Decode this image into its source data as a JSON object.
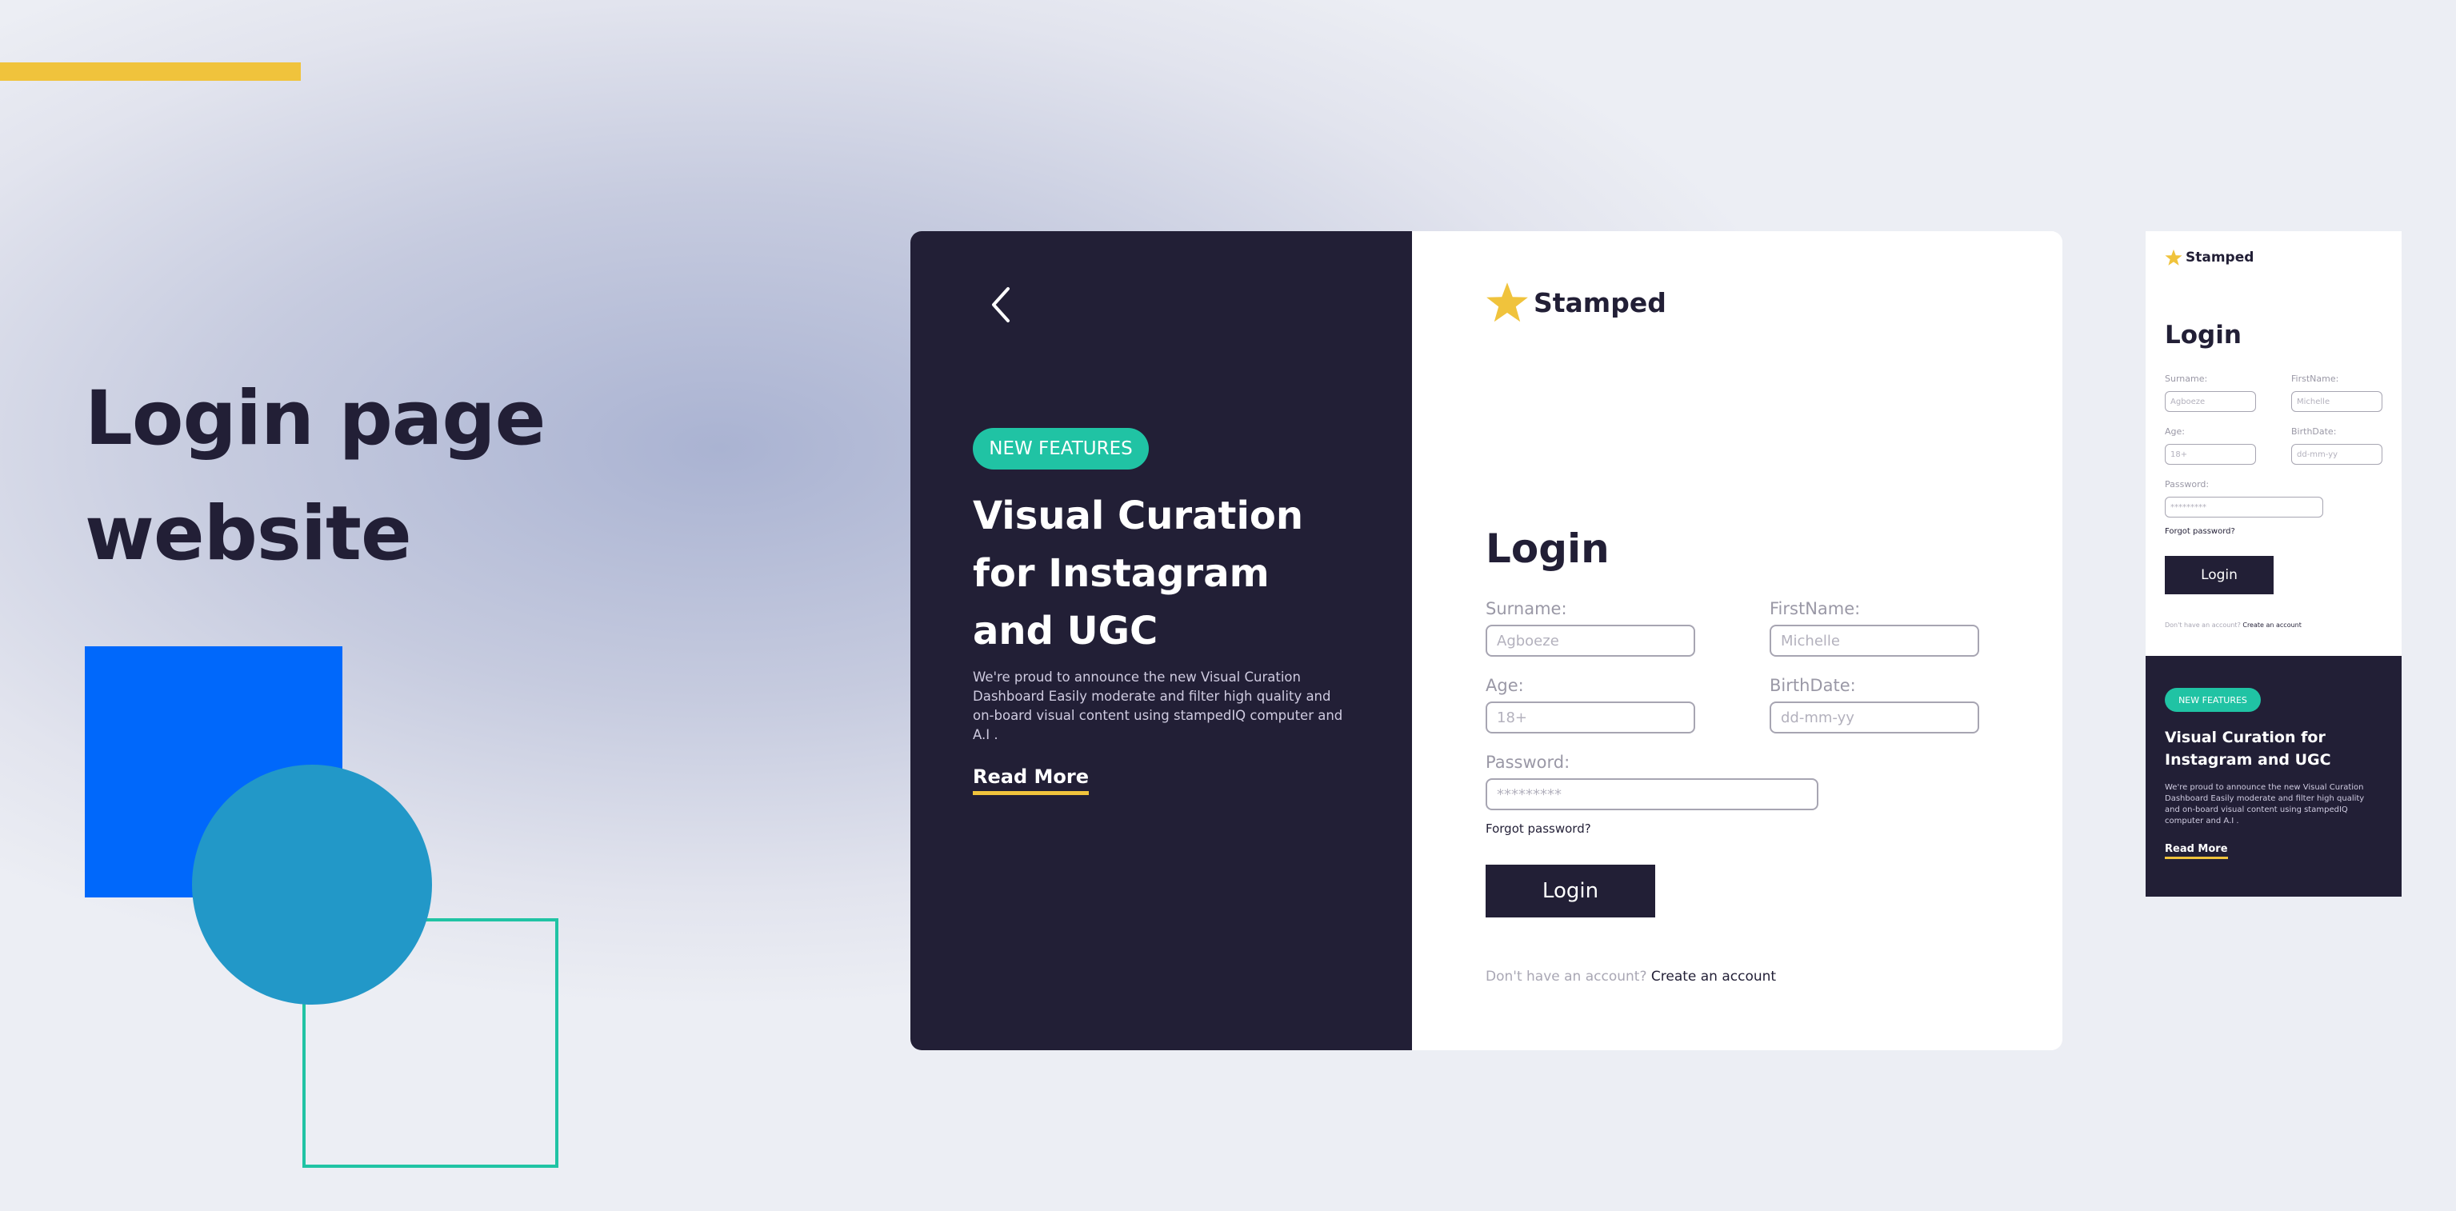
{
  "hero": {
    "title_line1": "Login page",
    "title_line2": "website"
  },
  "brand": {
    "name": "Stamped"
  },
  "promo": {
    "badge": "NEW FEATURES",
    "headline": "Visual Curation for Instagram and UGC",
    "body": "We're proud to announce the new Visual Curation Dashboard Easily moderate and filter high quality and on-board visual content using stampedIQ computer and A.I .",
    "read_more": "Read More"
  },
  "login": {
    "title": "Login",
    "surname_label": "Surname:",
    "surname_placeholder": "Agboeze",
    "firstname_label": "FirstName:",
    "firstname_placeholder": "Michelle",
    "age_label": "Age:",
    "age_placeholder": "18+",
    "birthdate_label": "BirthDate:",
    "birthdate_placeholder": "dd-mm-yy",
    "password_label": "Password:",
    "password_placeholder": "*********",
    "forgot": "Forgot password?",
    "button": "Login",
    "no_account": "Don't have an account?",
    "create": "Create an account"
  },
  "colors": {
    "dark": "#221f36",
    "accent_yellow": "#f0c33c",
    "accent_teal": "#20c3a4",
    "blue": "#0068fb",
    "circle": "#2298c8"
  },
  "icons": {
    "back": "chevron-left-icon",
    "logo": "star-icon"
  }
}
